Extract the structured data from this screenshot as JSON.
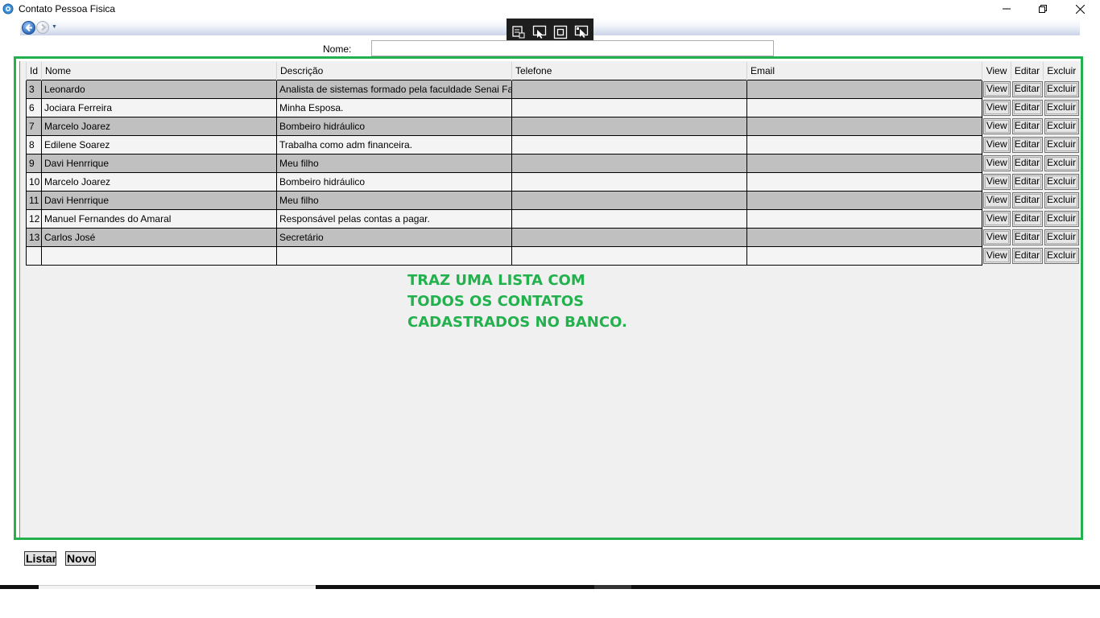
{
  "window": {
    "title": "Contato Pessoa Fisica",
    "minimize_glyph": "—",
    "maximize_glyph": "❐",
    "close_glyph": "✕"
  },
  "icons": {
    "app": "gear-window-icon",
    "nav_back": "back-arrow-icon",
    "nav_forward": "forward-arrow-icon",
    "toolbar": [
      "select-element-icon",
      "pointer-icon",
      "layout-adorner-icon",
      "track-focus-icon"
    ]
  },
  "search": {
    "label": "Nome:",
    "value": ""
  },
  "grid": {
    "columns": [
      "Id",
      "Nome",
      "Descrição",
      "Telefone",
      "Email",
      "View",
      "Editar",
      "Excluir"
    ],
    "rows": [
      {
        "id": "3",
        "nome": "Leonardo",
        "descricao": "Analista de sistemas formado pela faculdade Senai Fat",
        "telefone": "",
        "email": ""
      },
      {
        "id": "6",
        "nome": "Jociara Ferreira",
        "descricao": "Minha Esposa.",
        "telefone": "",
        "email": ""
      },
      {
        "id": "7",
        "nome": "Marcelo Joarez",
        "descricao": "Bombeiro hidráulico",
        "telefone": "",
        "email": ""
      },
      {
        "id": "8",
        "nome": "Edilene Soarez",
        "descricao": "Trabalha como adm financeira.",
        "telefone": "",
        "email": ""
      },
      {
        "id": "9",
        "nome": "Davi Henrrique",
        "descricao": "Meu filho",
        "telefone": "",
        "email": ""
      },
      {
        "id": "10",
        "nome": "Marcelo Joarez",
        "descricao": "Bombeiro hidráulico",
        "telefone": "",
        "email": ""
      },
      {
        "id": "11",
        "nome": "Davi Henrrique",
        "descricao": "Meu filho",
        "telefone": "",
        "email": ""
      },
      {
        "id": "12",
        "nome": "Manuel Fernandes do Amaral",
        "descricao": "Responsável pelas contas a pagar.",
        "telefone": "",
        "email": ""
      },
      {
        "id": "13",
        "nome": "Carlos José",
        "descricao": "Secretário",
        "telefone": "",
        "email": ""
      },
      {
        "id": "",
        "nome": "",
        "descricao": "",
        "telefone": "",
        "email": ""
      }
    ],
    "button_labels": {
      "view": "View",
      "editar": "Editar",
      "excluir": "Excluir"
    }
  },
  "annotation": {
    "lines": [
      "TRAZ UMA LISTA COM",
      "TODOS OS CONTATOS",
      "CADASTRADOS NO BANCO."
    ],
    "color": "#22b14c"
  },
  "actions": {
    "listar_label": "Listar",
    "novo_label": "Novo"
  },
  "colors": {
    "frame": "#22b14c",
    "row_alt": "#c0c0c0",
    "row": "#f4f4f4"
  }
}
